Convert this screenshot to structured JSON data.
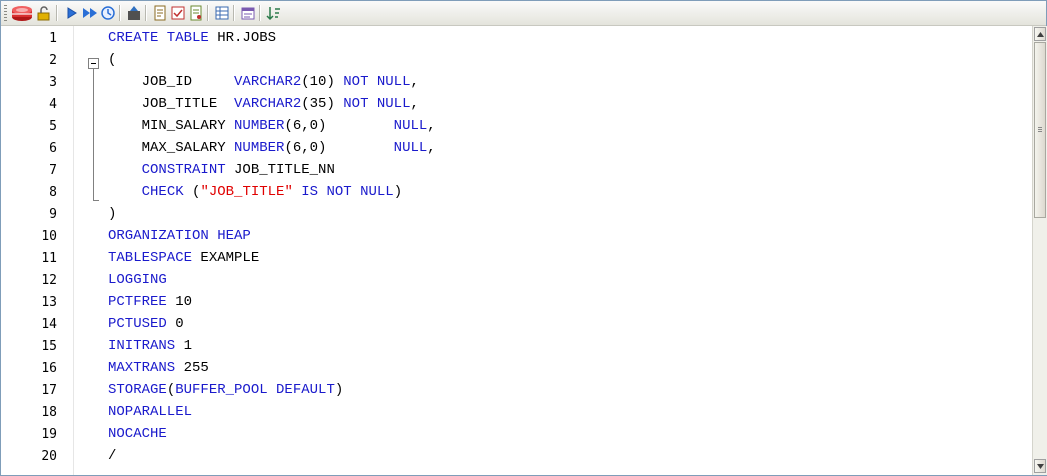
{
  "toolbar": {
    "buttons": [
      {
        "icon": "database-icon",
        "color": "#d83030"
      },
      {
        "icon": "lock-icon",
        "color": "#d4a000"
      },
      {
        "icon": "execute-icon",
        "color": "#2a6fd6"
      },
      {
        "icon": "execute-script-icon",
        "color": "#2a6fd6"
      },
      {
        "icon": "explain-plan-icon",
        "color": "#2a6fd6"
      },
      {
        "icon": "commit-icon",
        "color": "#404040"
      },
      {
        "icon": "format-icon",
        "color": "#8a6a20"
      },
      {
        "icon": "compile-icon",
        "color": "#c03030"
      },
      {
        "icon": "describe-icon",
        "color": "#6a8a30"
      },
      {
        "icon": "grid-icon",
        "color": "#3a6ab0"
      },
      {
        "icon": "properties-icon",
        "color": "#7a5ab0"
      },
      {
        "icon": "sort-icon",
        "color": "#2a7a4a"
      }
    ]
  },
  "editor": {
    "lines": [
      {
        "n": "1",
        "tokens": [
          {
            "t": "CREATE TABLE ",
            "c": "kw"
          },
          {
            "t": "HR.JOBS",
            "c": ""
          }
        ]
      },
      {
        "n": "2",
        "tokens": [
          {
            "t": "(",
            "c": ""
          }
        ]
      },
      {
        "n": "3",
        "tokens": [
          {
            "t": "    JOB_ID     ",
            "c": ""
          },
          {
            "t": "VARCHAR2",
            "c": "kw"
          },
          {
            "t": "(10) ",
            "c": ""
          },
          {
            "t": "NOT NULL",
            "c": "kw"
          },
          {
            "t": ",",
            "c": ""
          }
        ]
      },
      {
        "n": "4",
        "tokens": [
          {
            "t": "    JOB_TITLE  ",
            "c": ""
          },
          {
            "t": "VARCHAR2",
            "c": "kw"
          },
          {
            "t": "(35) ",
            "c": ""
          },
          {
            "t": "NOT NULL",
            "c": "kw"
          },
          {
            "t": ",",
            "c": ""
          }
        ]
      },
      {
        "n": "5",
        "tokens": [
          {
            "t": "    MIN_SALARY ",
            "c": ""
          },
          {
            "t": "NUMBER",
            "c": "kw"
          },
          {
            "t": "(6,0)        ",
            "c": ""
          },
          {
            "t": "NULL",
            "c": "kw"
          },
          {
            "t": ",",
            "c": ""
          }
        ]
      },
      {
        "n": "6",
        "tokens": [
          {
            "t": "    MAX_SALARY ",
            "c": ""
          },
          {
            "t": "NUMBER",
            "c": "kw"
          },
          {
            "t": "(6,0)        ",
            "c": ""
          },
          {
            "t": "NULL",
            "c": "kw"
          },
          {
            "t": ",",
            "c": ""
          }
        ]
      },
      {
        "n": "7",
        "tokens": [
          {
            "t": "    ",
            "c": ""
          },
          {
            "t": "CONSTRAINT",
            "c": "kw"
          },
          {
            "t": " JOB_TITLE_NN",
            "c": ""
          }
        ]
      },
      {
        "n": "8",
        "tokens": [
          {
            "t": "    ",
            "c": ""
          },
          {
            "t": "CHECK",
            "c": "kw"
          },
          {
            "t": " (",
            "c": ""
          },
          {
            "t": "\"JOB_TITLE\"",
            "c": "str"
          },
          {
            "t": " IS NOT NULL",
            "c": "kw"
          },
          {
            "t": ")",
            "c": ""
          }
        ]
      },
      {
        "n": "9",
        "tokens": [
          {
            "t": ")",
            "c": ""
          }
        ]
      },
      {
        "n": "10",
        "tokens": [
          {
            "t": "ORGANIZATION HEAP",
            "c": "kw"
          }
        ]
      },
      {
        "n": "11",
        "tokens": [
          {
            "t": "TABLESPACE",
            "c": "kw"
          },
          {
            "t": " EXAMPLE",
            "c": ""
          }
        ]
      },
      {
        "n": "12",
        "tokens": [
          {
            "t": "LOGGING",
            "c": "kw"
          }
        ]
      },
      {
        "n": "13",
        "tokens": [
          {
            "t": "PCTFREE",
            "c": "kw"
          },
          {
            "t": " 10",
            "c": ""
          }
        ]
      },
      {
        "n": "14",
        "tokens": [
          {
            "t": "PCTUSED",
            "c": "kw"
          },
          {
            "t": " 0",
            "c": ""
          }
        ]
      },
      {
        "n": "15",
        "tokens": [
          {
            "t": "INITRANS",
            "c": "kw"
          },
          {
            "t": " 1",
            "c": ""
          }
        ]
      },
      {
        "n": "16",
        "tokens": [
          {
            "t": "MAXTRANS",
            "c": "kw"
          },
          {
            "t": " 255",
            "c": ""
          }
        ]
      },
      {
        "n": "17",
        "tokens": [
          {
            "t": "STORAGE",
            "c": "kw"
          },
          {
            "t": "(",
            "c": ""
          },
          {
            "t": "BUFFER_POOL DEFAULT",
            "c": "kw"
          },
          {
            "t": ")",
            "c": ""
          }
        ]
      },
      {
        "n": "18",
        "tokens": [
          {
            "t": "NOPARALLEL",
            "c": "kw"
          }
        ]
      },
      {
        "n": "19",
        "tokens": [
          {
            "t": "NOCACHE",
            "c": "kw"
          }
        ]
      },
      {
        "n": "20",
        "tokens": [
          {
            "t": "/",
            "c": ""
          }
        ]
      }
    ]
  }
}
